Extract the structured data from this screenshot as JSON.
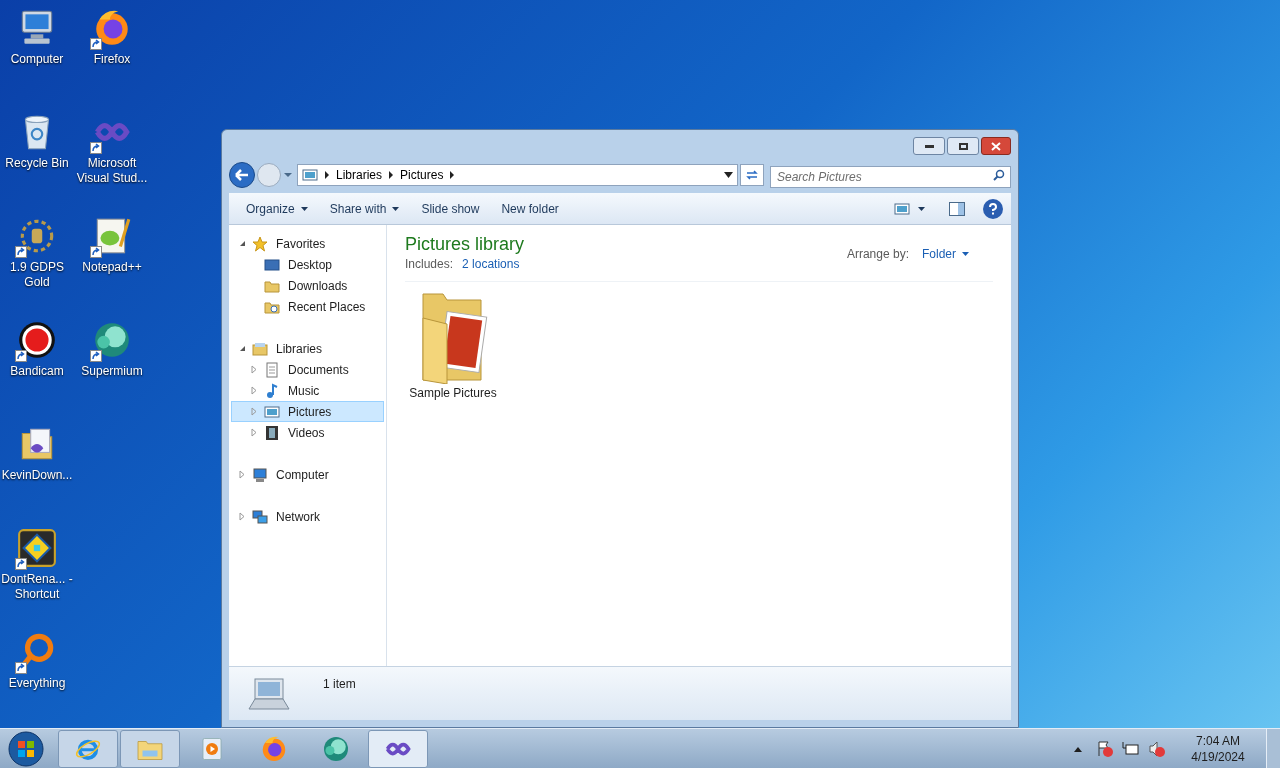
{
  "desktop_icons": [
    [
      {
        "label": "Computer",
        "kind": "computer",
        "shortcut": false
      },
      {
        "label": "Recycle Bin",
        "kind": "recycle",
        "shortcut": false
      },
      {
        "label": "1.9 GDPS Gold",
        "kind": "gdps",
        "shortcut": true
      },
      {
        "label": "Bandicam",
        "kind": "bandicam",
        "shortcut": true
      },
      {
        "label": "KevinDown...",
        "kind": "folder",
        "shortcut": false
      },
      {
        "label": "DontRena... - Shortcut",
        "kind": "gd",
        "shortcut": true
      },
      {
        "label": "Everything",
        "kind": "everything",
        "shortcut": true
      }
    ],
    [
      {
        "label": "Firefox",
        "kind": "firefox",
        "shortcut": true
      },
      {
        "label": "Microsoft Visual Stud...",
        "kind": "vs",
        "shortcut": true
      },
      {
        "label": "Notepad++",
        "kind": "notepad",
        "shortcut": true
      },
      {
        "label": "Supermium",
        "kind": "supermium",
        "shortcut": true
      }
    ]
  ],
  "window": {
    "address": [
      "Libraries",
      "Pictures"
    ],
    "search": {
      "placeholder": "Search Pictures"
    },
    "toolbar": [
      {
        "label": "Organize",
        "dropdown": true
      },
      {
        "label": "Share with",
        "dropdown": true
      },
      {
        "label": "Slide show",
        "dropdown": false
      },
      {
        "label": "New folder",
        "dropdown": false
      }
    ],
    "nav": [
      {
        "label": "Favorites",
        "kind": "star",
        "expanded": true,
        "selected": false,
        "children": [
          {
            "label": "Desktop",
            "kind": "desktop",
            "selected": false
          },
          {
            "label": "Downloads",
            "kind": "folder",
            "selected": false
          },
          {
            "label": "Recent Places",
            "kind": "recent",
            "selected": false
          }
        ]
      },
      {
        "label": "Libraries",
        "kind": "library",
        "expanded": true,
        "selected": false,
        "children": [
          {
            "label": "Documents",
            "kind": "documents",
            "expanded": false,
            "selected": false
          },
          {
            "label": "Music",
            "kind": "music",
            "expanded": false,
            "selected": false
          },
          {
            "label": "Pictures",
            "kind": "pictures",
            "expanded": false,
            "selected": true
          },
          {
            "label": "Videos",
            "kind": "videos",
            "expanded": false,
            "selected": false
          }
        ]
      },
      {
        "label": "Computer",
        "kind": "computer",
        "expanded": false,
        "selected": false
      },
      {
        "label": "Network",
        "kind": "network",
        "expanded": false,
        "selected": false
      }
    ],
    "library": {
      "title": "Pictures library",
      "includes_label": "Includes:",
      "includes_link": "2 locations",
      "arrange_label": "Arrange by:",
      "arrange_value": "Folder"
    },
    "items": [
      {
        "label": "Sample Pictures"
      }
    ],
    "status": "1 item"
  },
  "taskbar": {
    "apps": [
      {
        "kind": "ie",
        "running": true,
        "active": false
      },
      {
        "kind": "explorer",
        "running": true,
        "active": false
      },
      {
        "kind": "media",
        "running": false,
        "active": false
      },
      {
        "kind": "firefox",
        "running": false,
        "active": false
      },
      {
        "kind": "supermium",
        "running": false,
        "active": false
      },
      {
        "kind": "vs",
        "running": true,
        "active": true
      }
    ],
    "time": "7:04 AM",
    "date": "4/19/2024"
  }
}
